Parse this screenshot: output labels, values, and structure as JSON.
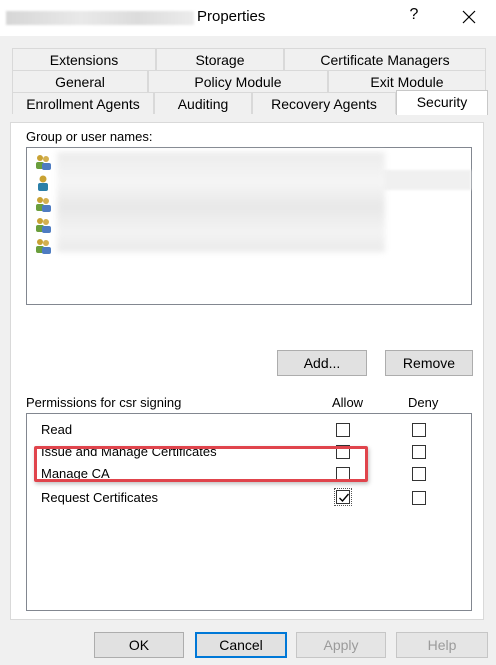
{
  "window": {
    "title": "Properties",
    "help_label": "?",
    "close_icon": "close-icon"
  },
  "tabs": {
    "row1": [
      "Extensions",
      "Storage",
      "Certificate Managers"
    ],
    "row2": [
      "General",
      "Policy Module",
      "Exit Module"
    ],
    "row3": [
      "Enrollment Agents",
      "Auditing",
      "Recovery Agents",
      "Security"
    ],
    "active": "Security"
  },
  "security": {
    "group_label": "Group or user names:",
    "add_button": "Add...",
    "remove_button": "Remove",
    "permissions_label": "Permissions for csr signing",
    "allow_header": "Allow",
    "deny_header": "Deny",
    "permissions": [
      {
        "name": "Read",
        "allow": false,
        "deny": false
      },
      {
        "name": "Issue and Manage Certificates",
        "allow": false,
        "deny": false
      },
      {
        "name": "Manage CA",
        "allow": false,
        "deny": false
      },
      {
        "name": "Request Certificates",
        "allow": true,
        "deny": false
      }
    ]
  },
  "footer": {
    "ok": "OK",
    "cancel": "Cancel",
    "apply": "Apply",
    "help": "Help"
  },
  "colors": {
    "highlight": "#e0444c",
    "default_button_border": "#0078d7"
  }
}
